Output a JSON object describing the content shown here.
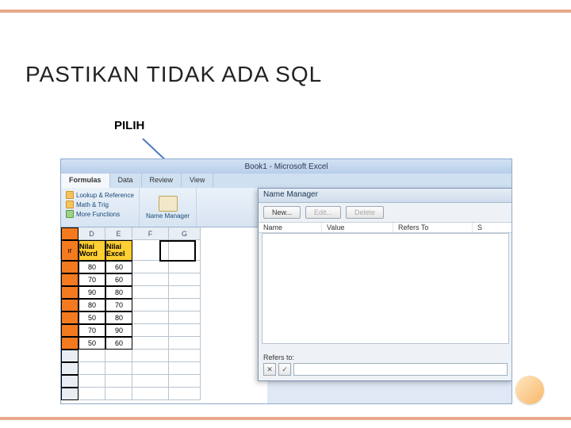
{
  "slide": {
    "title": "PASTIKAN TIDAK ADA SQL",
    "annotation": "PILIH"
  },
  "excel": {
    "titlebar": "Book1 - Microsoft Excel",
    "tabs": [
      "Formulas",
      "Data",
      "Review",
      "View"
    ],
    "ribbon": {
      "lookup": "Lookup & Reference",
      "math": "Math & Trig",
      "more": "More Functions",
      "name_manager": "Name\nManager"
    },
    "columns": [
      "D",
      "E",
      "F",
      "G"
    ],
    "headers": {
      "d": "Nilai\nWord",
      "e": "Nilai\nExcel"
    },
    "rows": [
      {
        "d": "80",
        "e": "60"
      },
      {
        "d": "70",
        "e": "60"
      },
      {
        "d": "90",
        "e": "80"
      },
      {
        "d": "80",
        "e": "70"
      },
      {
        "d": "50",
        "e": "80"
      },
      {
        "d": "70",
        "e": "90"
      },
      {
        "d": "50",
        "e": "60"
      }
    ]
  },
  "dialog": {
    "title": "Name Manager",
    "buttons": {
      "new": "New...",
      "edit": "Edit...",
      "delete": "Delete"
    },
    "cols": [
      "Name",
      "Value",
      "Refers To",
      "S"
    ],
    "refers_label": "Refers to:",
    "x": "✕",
    "check": "✓"
  }
}
